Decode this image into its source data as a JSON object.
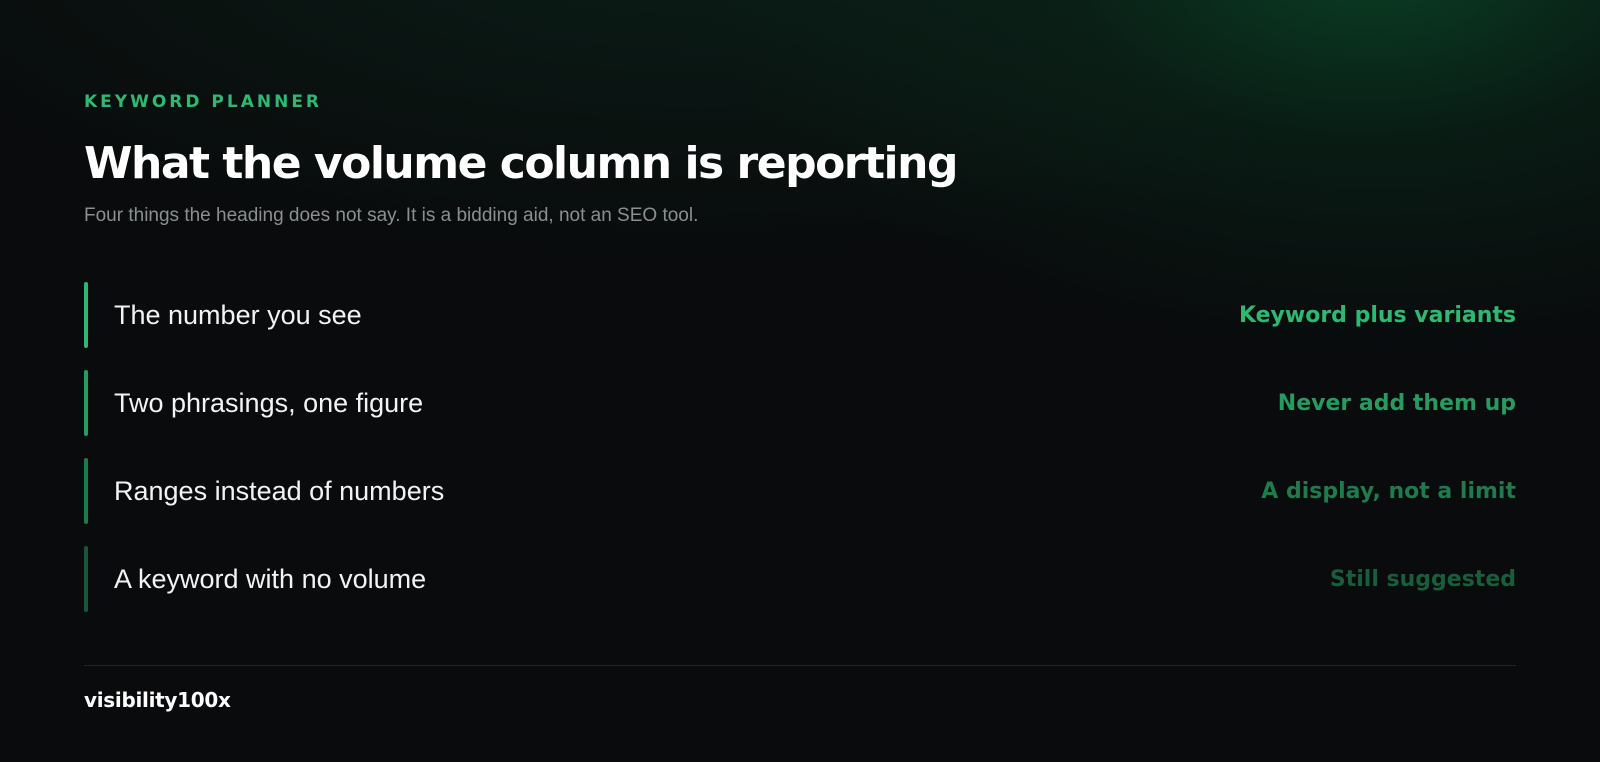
{
  "header": {
    "eyebrow": "KEYWORD PLANNER",
    "title": "What the volume column is reporting",
    "subtitle": "Four things the heading does not say. It is a bidding aid, not an SEO tool."
  },
  "rows": [
    {
      "label": "The number you see",
      "value": "Keyword plus variants",
      "accent": "#2fb872",
      "bar": "#2fb872"
    },
    {
      "label": "Two phrasings, one figure",
      "value": "Never add them up",
      "accent": "#279a61",
      "bar": "#259c60"
    },
    {
      "label": "Ranges instead of numbers",
      "value": "A display, not a limit",
      "accent": "#1f7a4d",
      "bar": "#1d7c4c"
    },
    {
      "label": "A keyword with no volume",
      "value": "Still suggested",
      "accent": "#185e3c",
      "bar": "#16573a"
    }
  ],
  "footer": {
    "brand": "visibility100x"
  },
  "colors": {
    "accent": "#2fb872",
    "background": "#090b0c",
    "muted_text": "#8a8f92"
  }
}
